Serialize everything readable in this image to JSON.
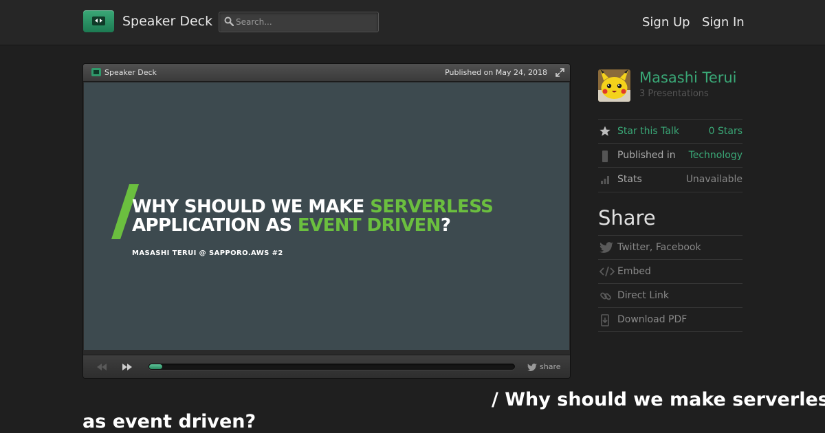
{
  "header": {
    "brand": "Speaker Deck",
    "search_placeholder": "Search...",
    "sign_up": "Sign Up",
    "sign_in": "Sign In"
  },
  "player": {
    "brand": "Speaker Deck",
    "published": "Published on May 24, 2018",
    "share_label": "share",
    "progress_fraction": 0.035,
    "slide": {
      "title_line1_white": "WHY SHOULD WE MAKE ",
      "title_line1_green": "SERVERLESS",
      "title_line2_white": "APPLICATION AS ",
      "title_line2_green": "EVENT DRIVEN",
      "title_line2_end": "?",
      "author_line": "MASASHI TERUI @ SAPPORO.AWS #2"
    }
  },
  "sidebar": {
    "author_name": "Masashi Terui",
    "author_presentations": "3 Presentations",
    "rows": [
      {
        "label": "Star this Talk",
        "value": "0 Stars",
        "icon": "star-icon"
      },
      {
        "label": "Published in",
        "value": "Technology",
        "icon": "bookmark-icon"
      },
      {
        "label": "Stats",
        "value": "Unavailable",
        "icon": "stats-icon"
      }
    ],
    "share_heading": "Share",
    "share_items": [
      {
        "label": "Twitter, Facebook",
        "icon": "twitter-icon"
      },
      {
        "label": "Embed",
        "icon": "embed-icon"
      },
      {
        "label": "Direct Link",
        "icon": "link-icon"
      },
      {
        "label": "Download PDF",
        "icon": "download-pdf-icon"
      }
    ]
  },
  "talk": {
    "title_part1": "/ Why should we make serverless application",
    "title_part2": "as event driven?"
  },
  "colors": {
    "accent_green": "#3aa877",
    "slide_green": "#6bbf3f",
    "slide_background": "#3d4a4f",
    "page_background": "#1f1f1f"
  }
}
